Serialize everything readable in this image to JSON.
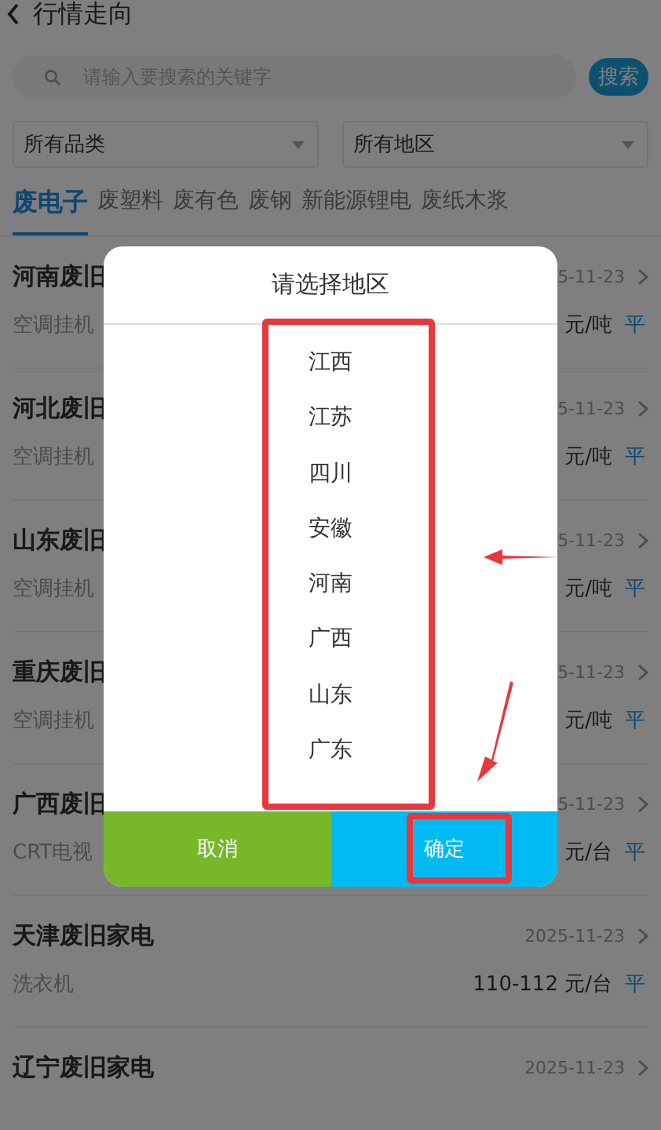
{
  "header": {
    "title": "行情走向"
  },
  "search": {
    "placeholder": "请输入要搜索的关键字",
    "button": "搜索"
  },
  "filters": [
    {
      "label": "所有品类"
    },
    {
      "label": "所有地区"
    }
  ],
  "tabs": [
    {
      "label": "废电子",
      "selected": true
    },
    {
      "label": "废塑料",
      "selected": false
    },
    {
      "label": "废有色",
      "selected": false
    },
    {
      "label": "废钢",
      "selected": false
    },
    {
      "label": "新能源锂电",
      "selected": false
    },
    {
      "label": "废纸木浆",
      "selected": false
    }
  ],
  "rows": [
    {
      "title": "河南废旧",
      "date": "5-11-23",
      "category": "空调挂机",
      "price": "元/吨",
      "trend": "平"
    },
    {
      "title": "河北废旧",
      "date": "5-11-23",
      "category": "空调挂机",
      "price": "元/吨",
      "trend": "平"
    },
    {
      "title": "山东废旧",
      "date": "5-11-23",
      "category": "空调挂机",
      "price": "元/吨",
      "trend": "平"
    },
    {
      "title": "重庆废旧",
      "date": "5-11-23",
      "category": "空调挂机",
      "price": "元/吨",
      "trend": "平"
    },
    {
      "title": "广西废旧",
      "date": "5-11-23",
      "category": "CRT电视",
      "price": "元/台",
      "trend": "平"
    },
    {
      "title": "天津废旧家电",
      "date": "2025-11-23",
      "category": "洗衣机",
      "price": "110-112 元/台",
      "trend": "平"
    },
    {
      "title": "辽宁废旧家电",
      "date": "2025-11-23"
    }
  ],
  "dialog": {
    "title": "请选择地区",
    "options": [
      "江西",
      "江苏",
      "四川",
      "安徽",
      "河南",
      "广西",
      "山东",
      "广东"
    ],
    "cancel": "取消",
    "confirm": "确定"
  }
}
